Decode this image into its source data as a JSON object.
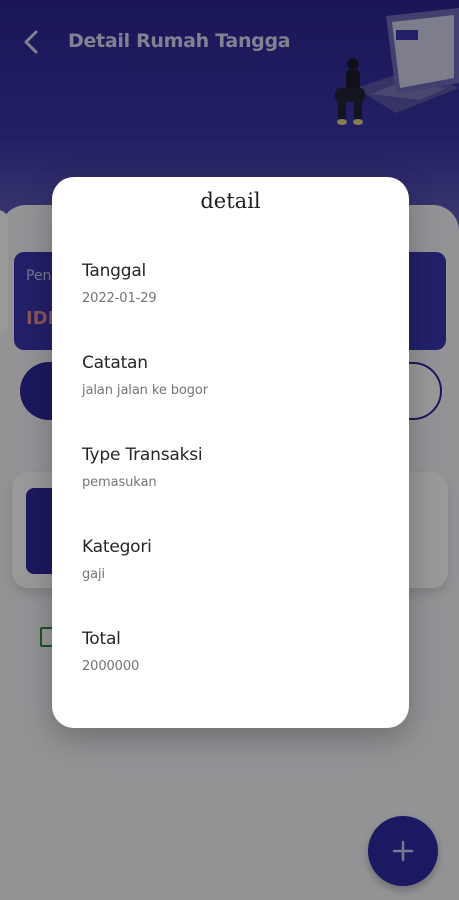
{
  "app_bar": {
    "title": "Detail Rumah Tangga",
    "back_icon": "chevron-left-icon"
  },
  "background": {
    "balance_label_partial": "Pen",
    "balance_value_partial": "IDI",
    "fab_icon": "plus-icon"
  },
  "dialog": {
    "title": "detail",
    "fields": [
      {
        "label": "Tanggal",
        "value": "2022-01-29"
      },
      {
        "label": "Catatan",
        "value": "jalan jalan ke bogor"
      },
      {
        "label": "Type Transaksi",
        "value": "pemasukan"
      },
      {
        "label": "Kategori",
        "value": "gaji"
      },
      {
        "label": "Total",
        "value": "2000000"
      }
    ]
  },
  "colors": {
    "primary": "#2e2aa3",
    "header_gradient_top": "#2c2693",
    "accent_text": "#e98a9a",
    "scrim": "rgba(0,0,0,0.40)"
  }
}
